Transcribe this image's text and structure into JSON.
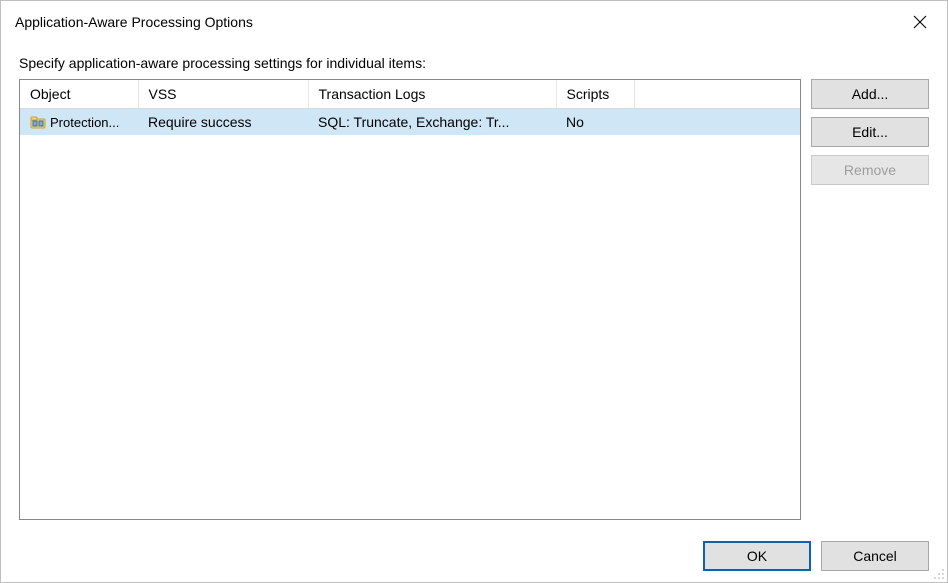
{
  "title": "Application-Aware Processing Options",
  "instruction": "Specify application-aware processing settings for individual items:",
  "columns": {
    "object": "Object",
    "vss": "VSS",
    "txlogs": "Transaction Logs",
    "scripts": "Scripts"
  },
  "rows": [
    {
      "object": "Protection...",
      "vss": "Require success",
      "txlogs": "SQL: Truncate, Exchange: Tr...",
      "scripts": "No",
      "selected": true
    }
  ],
  "buttons": {
    "add": "Add...",
    "edit": "Edit...",
    "remove": "Remove",
    "ok": "OK",
    "cancel": "Cancel"
  }
}
